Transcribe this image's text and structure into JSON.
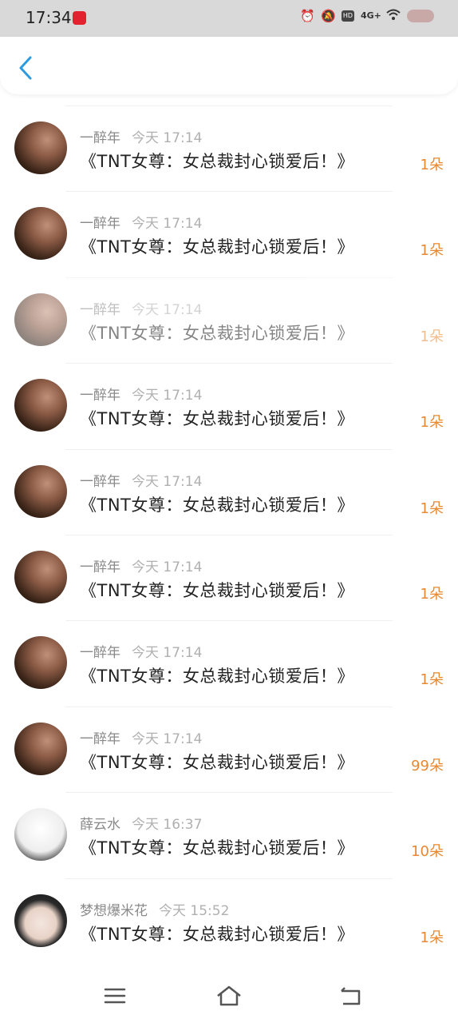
{
  "status": {
    "time": "17:34",
    "hd": "HD",
    "net": "4G+"
  },
  "header": {
    "back_icon": "chevron-left-icon",
    "accent": "#2c9be0"
  },
  "colors": {
    "count": "#e88830"
  },
  "rows": [
    {
      "name": "一醉年",
      "time": "今天 17:14",
      "title": "《TNT女尊：女总裁封心锁爱后！》",
      "count": "1朵"
    },
    {
      "name": "一醉年",
      "time": "今天 17:14",
      "title": "《TNT女尊：女总裁封心锁爱后！》",
      "count": "1朵"
    },
    {
      "name": "一醉年",
      "time": "今天 17:14",
      "title": "《TNT女尊：女总裁封心锁爱后！》",
      "count": "1朵"
    },
    {
      "name": "一醉年",
      "time": "今天 17:14",
      "title": "《TNT女尊：女总裁封心锁爱后！》",
      "count": "1朵"
    },
    {
      "name": "一醉年",
      "time": "今天 17:14",
      "title": "《TNT女尊：女总裁封心锁爱后！》",
      "count": "1朵"
    },
    {
      "name": "一醉年",
      "time": "今天 17:14",
      "title": "《TNT女尊：女总裁封心锁爱后！》",
      "count": "1朵"
    },
    {
      "name": "一醉年",
      "time": "今天 17:14",
      "title": "《TNT女尊：女总裁封心锁爱后！》",
      "count": "1朵"
    },
    {
      "name": "一醉年",
      "time": "今天 17:14",
      "title": "《TNT女尊：女总裁封心锁爱后！》",
      "count": "99朵"
    },
    {
      "name": "薛云水",
      "time": "今天 16:37",
      "title": "《TNT女尊：女总裁封心锁爱后！》",
      "count": "10朵"
    },
    {
      "name": "梦想爆米花",
      "time": "今天 15:52",
      "title": "《TNT女尊：女总裁封心锁爱后！》",
      "count": "1朵"
    }
  ],
  "nav": {
    "menu_icon": "menu-icon",
    "home_icon": "home-icon",
    "back_icon": "back-icon"
  }
}
